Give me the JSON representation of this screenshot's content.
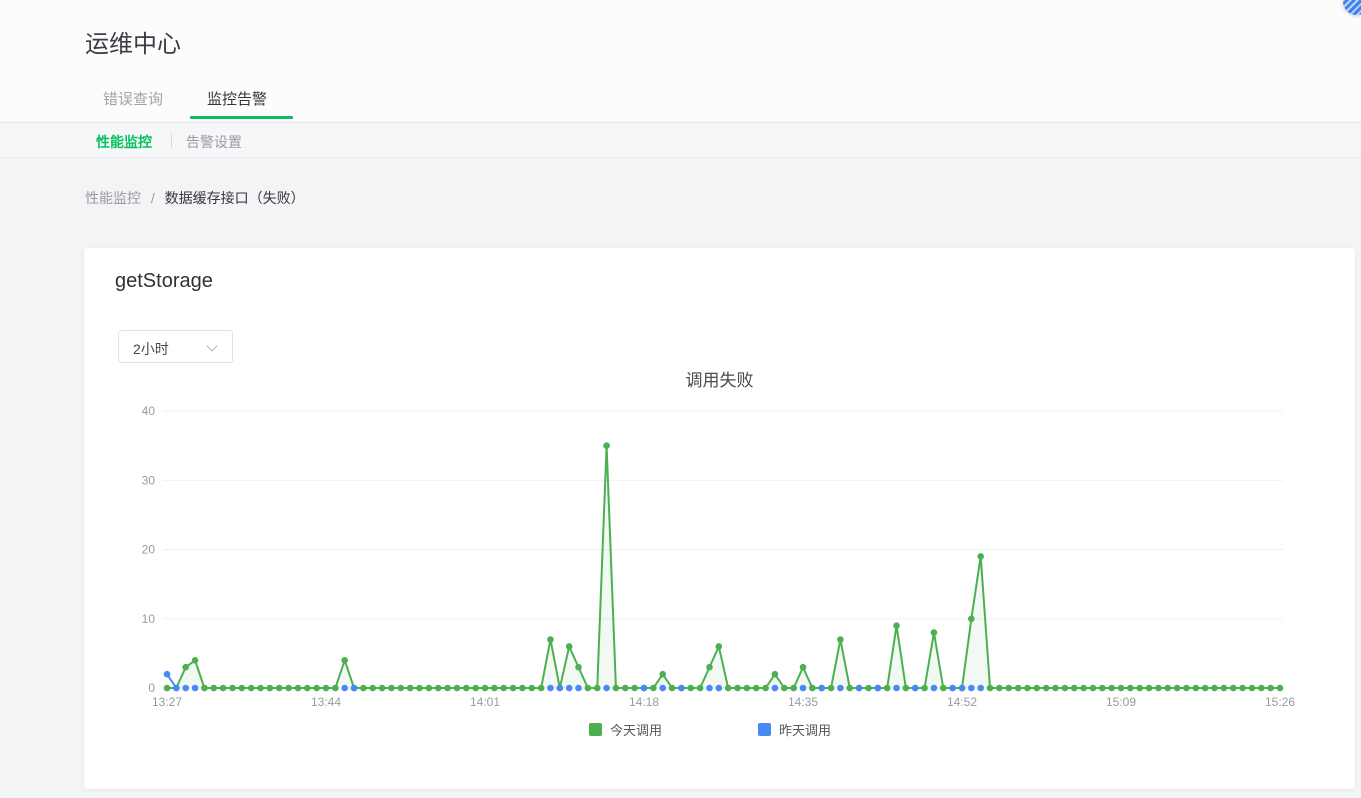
{
  "page": {
    "title": "运维中心"
  },
  "tabs": [
    {
      "label": "错误查询",
      "active": false
    },
    {
      "label": "监控告警",
      "active": true
    }
  ],
  "subtabs": [
    {
      "label": "性能监控",
      "active": true
    },
    {
      "label": "告警设置",
      "active": false
    }
  ],
  "breadcrumb": {
    "parent": "性能监控",
    "separator": "/",
    "current": "数据缓存接口（失败）"
  },
  "card": {
    "title": "getStorage",
    "range_select": {
      "value": "2小时"
    }
  },
  "chart_data": {
    "type": "line",
    "title": "调用失败",
    "ylim": [
      0,
      40
    ],
    "y_ticks": [
      0,
      10,
      20,
      30,
      40
    ],
    "grid": true,
    "legend_position": "bottom",
    "x_ticks": [
      {
        "index": 0,
        "label": "13:27"
      },
      {
        "index": 17,
        "label": "13:44"
      },
      {
        "index": 34,
        "label": "14:01"
      },
      {
        "index": 51,
        "label": "14:18"
      },
      {
        "index": 68,
        "label": "14:35"
      },
      {
        "index": 85,
        "label": "14:52"
      },
      {
        "index": 102,
        "label": "15:09"
      },
      {
        "index": 119,
        "label": "15:26"
      }
    ],
    "series": [
      {
        "name": "今天调用",
        "color": "#4caf50",
        "values": [
          0,
          0,
          3,
          4,
          0,
          0,
          0,
          0,
          0,
          0,
          0,
          0,
          0,
          0,
          0,
          0,
          0,
          0,
          0,
          4,
          0,
          0,
          0,
          0,
          0,
          0,
          0,
          0,
          0,
          0,
          0,
          0,
          0,
          0,
          0,
          0,
          0,
          0,
          0,
          0,
          0,
          7,
          0,
          6,
          3,
          0,
          0,
          35,
          0,
          0,
          0,
          0,
          0,
          2,
          0,
          0,
          0,
          0,
          3,
          6,
          0,
          0,
          0,
          0,
          0,
          2,
          0,
          0,
          3,
          0,
          0,
          0,
          7,
          0,
          0,
          0,
          0,
          0,
          9,
          0,
          0,
          0,
          8,
          0,
          0,
          0,
          10,
          19,
          0,
          0,
          0,
          0,
          0,
          0,
          0,
          0,
          0,
          0,
          0,
          0,
          0,
          0,
          0,
          0,
          0,
          0,
          0,
          0,
          0,
          0,
          0,
          0,
          0,
          0,
          0,
          0,
          0,
          0,
          0,
          0
        ]
      },
      {
        "name": "昨天调用",
        "color": "#4989f5",
        "values": [
          2,
          0,
          0,
          0,
          0,
          0,
          0,
          0,
          0,
          0,
          0,
          0,
          0,
          0,
          0,
          0,
          0,
          0,
          0,
          0,
          0,
          0,
          0,
          0,
          0,
          0,
          0,
          0,
          0,
          0,
          0,
          0,
          0,
          0,
          0,
          0,
          0,
          0,
          0,
          0,
          0,
          0,
          0,
          0,
          0,
          0,
          0,
          0,
          0,
          0,
          0,
          0,
          0,
          0,
          0,
          0,
          0,
          0,
          0,
          0,
          0,
          0,
          0,
          0,
          0,
          0,
          0,
          0,
          0,
          0,
          0,
          0,
          0,
          0,
          0,
          0,
          0,
          0,
          0,
          0,
          0,
          0,
          0,
          0,
          0,
          0,
          0,
          0,
          0,
          0,
          0,
          0,
          0,
          0,
          0,
          0,
          0,
          0,
          0,
          0,
          0,
          0,
          0,
          0,
          0,
          0,
          0,
          0,
          0,
          0,
          0,
          0,
          0,
          0,
          0,
          0,
          0,
          0,
          0,
          0
        ]
      }
    ],
    "yesterday_visible_dot_indices": [
      1,
      2,
      3,
      19,
      20,
      41,
      42,
      43,
      44,
      47,
      51,
      53,
      55,
      58,
      59,
      65,
      68,
      70,
      72,
      74,
      76,
      78,
      80,
      82,
      84,
      85,
      86,
      87
    ]
  },
  "colors": {
    "accent_green": "#07c160",
    "today_series": "#4caf50",
    "yesterday_series": "#4989f5"
  }
}
